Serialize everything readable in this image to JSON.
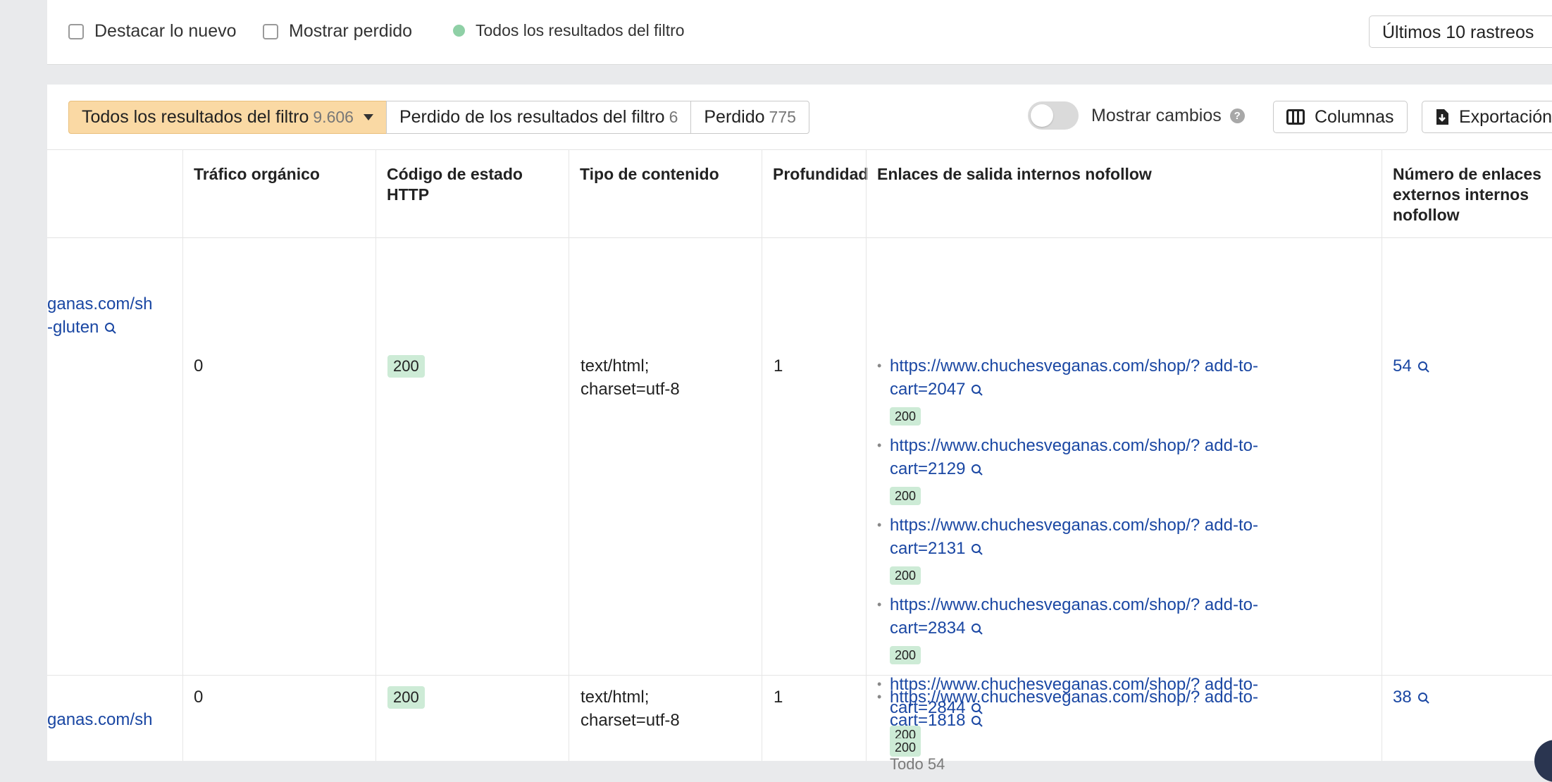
{
  "filters": {
    "highlight_new": "Destacar lo nuevo",
    "show_lost": "Mostrar perdido",
    "status_label": "Todos los resultados del filtro",
    "crawls_select": "Últimos 10 rastreos"
  },
  "tabs": [
    {
      "label": "Todos los resultados del filtro",
      "count": "9.606"
    },
    {
      "label": "Perdido de los resultados del filtro",
      "count": "6"
    },
    {
      "label": "Perdido",
      "count": "775"
    }
  ],
  "toolbar": {
    "show_changes": "Mostrar cambios",
    "help": "?",
    "columns": "Columnas",
    "export": "Exportación"
  },
  "columns": {
    "traffic": "Tráfico orgánico",
    "http_status": "Código de estado HTTP",
    "content_type": "Tipo de contenido",
    "depth": "Profundidad",
    "nofollow_links": "Enlaces de salida internos nofollow",
    "external_count": "Número de enlaces externos internos nofollow"
  },
  "rows": [
    {
      "url_line1": "ganas.com/sh",
      "url_line2": "-gluten",
      "traffic": "0",
      "status": "200",
      "content_type": "text/html; charset=utf-8",
      "depth": "1",
      "links": [
        {
          "line1": "https://www.chuchesveganas.com/shop/? add-to-",
          "line2": "cart=2047",
          "status": "200"
        },
        {
          "line1": "https://www.chuchesveganas.com/shop/? add-to-",
          "line2": "cart=2129",
          "status": "200"
        },
        {
          "line1": "https://www.chuchesveganas.com/shop/? add-to-",
          "line2": "cart=2131",
          "status": "200"
        },
        {
          "line1": "https://www.chuchesveganas.com/shop/? add-to-",
          "line2": "cart=2834",
          "status": "200"
        },
        {
          "line1": "https://www.chuchesveganas.com/shop/? add-to-",
          "line2": "cart=2844",
          "status": "200"
        }
      ],
      "all_label": "Todo 54",
      "external_count": "54"
    },
    {
      "url_line1": "ganas.com/sh",
      "traffic": "0",
      "status": "200",
      "content_type": "text/html; charset=utf-8",
      "depth": "1",
      "links": [
        {
          "line1": "https://www.chuchesveganas.com/shop/? add-to-",
          "line2": "cart=1818",
          "status": "200"
        }
      ],
      "external_count": "38"
    }
  ]
}
